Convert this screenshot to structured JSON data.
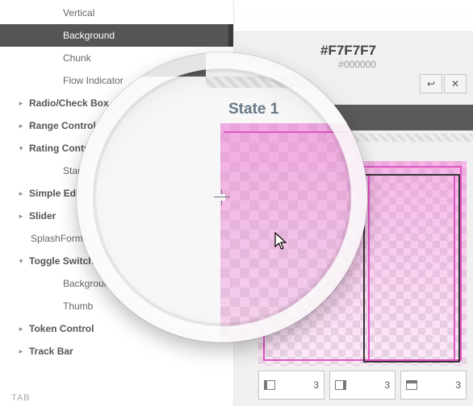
{
  "sidebar": {
    "items": [
      {
        "label": "Vertical",
        "caret": "",
        "indent": 1,
        "bold": false,
        "selected": false
      },
      {
        "label": "Background",
        "caret": "",
        "indent": 1,
        "bold": false,
        "selected": true
      },
      {
        "label": "Chunk",
        "caret": "",
        "indent": 1,
        "bold": false,
        "selected": false
      },
      {
        "label": "Flow Indicator",
        "caret": "",
        "indent": 1,
        "bold": false,
        "selected": false
      },
      {
        "label": "Radio/Check Box",
        "caret": "▸",
        "indent": 0,
        "bold": true,
        "selected": false
      },
      {
        "label": "Range Control",
        "caret": "▸",
        "indent": 0,
        "bold": true,
        "selected": false
      },
      {
        "label": "Rating Control",
        "caret": "▾",
        "indent": 0,
        "bold": true,
        "selected": false
      },
      {
        "label": "Star Icon",
        "caret": "",
        "indent": 1,
        "bold": false,
        "selected": false
      },
      {
        "label": "Simple Editor",
        "caret": "▸",
        "indent": 0,
        "bold": true,
        "selected": false
      },
      {
        "label": "Slider",
        "caret": "▸",
        "indent": 0,
        "bold": true,
        "selected": false
      },
      {
        "label": "SplashForm",
        "caret": "",
        "indent": 0,
        "bold": false,
        "selected": false
      },
      {
        "label": "Toggle Switch",
        "caret": "▾",
        "indent": 0,
        "bold": true,
        "selected": false
      },
      {
        "label": "Background",
        "caret": "",
        "indent": 1,
        "bold": false,
        "selected": false
      },
      {
        "label": "Thumb",
        "caret": "",
        "indent": 1,
        "bold": false,
        "selected": false
      },
      {
        "label": "Token Control",
        "caret": "▸",
        "indent": 0,
        "bold": true,
        "selected": false
      },
      {
        "label": "Track Bar",
        "caret": "▸",
        "indent": 0,
        "bold": true,
        "selected": false
      }
    ],
    "footer": "TAB"
  },
  "eyedropper": {
    "main_hex": "#F7F7F7",
    "sub_hex": "#000000"
  },
  "toolbar": {
    "undo_glyph": "↩",
    "close_glyph": "✕"
  },
  "canvas": {
    "state_label": "State 1"
  },
  "margins": {
    "left": "3",
    "right": "3",
    "top": "3"
  }
}
